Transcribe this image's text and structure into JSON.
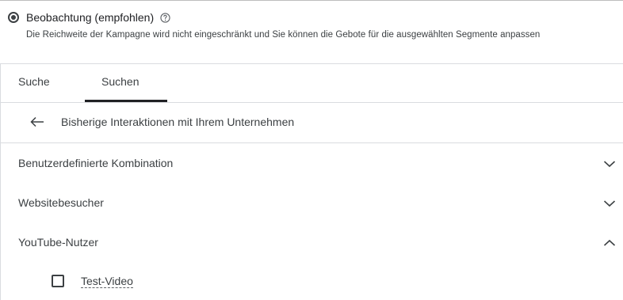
{
  "bidding": {
    "option_label": "Beobachtung (empfohlen)",
    "description": "Die Reichweite der Kampagne wird nicht eingeschränkt und Sie können die Gebote für die ausgewählten Segmente anpassen"
  },
  "tabs": [
    {
      "label": "Suche"
    },
    {
      "label": "Suchen"
    }
  ],
  "active_tab_index": 1,
  "back_row": {
    "label": "Bisherige Interaktionen mit Ihrem Unternehmen"
  },
  "sections": [
    {
      "label": "Benutzerdefinierte Kombination",
      "expanded": false
    },
    {
      "label": "Websitebesucher",
      "expanded": false
    },
    {
      "label": "YouTube-Nutzer",
      "expanded": true
    }
  ],
  "youtube_items": [
    {
      "label": "Test-Video",
      "checked": false
    }
  ],
  "colors": {
    "text": "#3c4043",
    "divider": "#dadce0",
    "accent": "#202124"
  }
}
